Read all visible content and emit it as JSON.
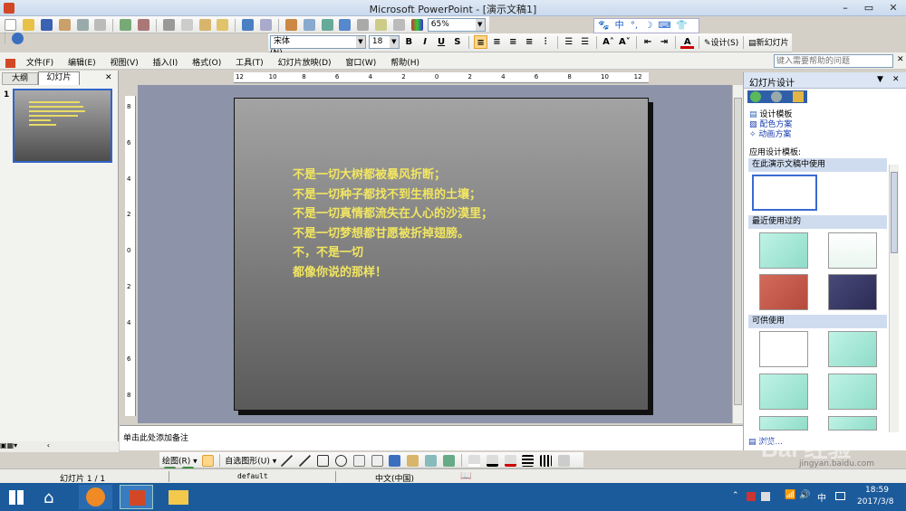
{
  "window": {
    "title": "Microsoft PowerPoint - [演示文稿1]",
    "minimize": "–",
    "restore": "▭",
    "close": "✕"
  },
  "toolbar_std": {
    "zoom": "65%"
  },
  "ime": {
    "lang": "中",
    "punct": "°,",
    "moon": "☽"
  },
  "format": {
    "font": "宋体",
    "size": "18",
    "bold": "B",
    "italic": "I",
    "underline": "U",
    "shadow": "S",
    "design_label": "设计(S)",
    "new_slide_label": "新幻灯片(N)"
  },
  "menubar": {
    "items": [
      "文件(F)",
      "编辑(E)",
      "视图(V)",
      "插入(I)",
      "格式(O)",
      "工具(T)",
      "幻灯片放映(D)",
      "窗口(W)",
      "帮助(H)"
    ],
    "help_search_placeholder": "键入需要帮助的问题"
  },
  "ruler": {
    "labels": [
      "12",
      "10",
      "8",
      "6",
      "4",
      "2",
      "0",
      "2",
      "4",
      "6",
      "8",
      "10",
      "12"
    ],
    "vlabels": [
      "8",
      "6",
      "4",
      "2",
      "0",
      "2",
      "4",
      "6",
      "8"
    ]
  },
  "outline_pane": {
    "tab_outline": "大纲",
    "tab_slides": "幻灯片",
    "slide_number": "1"
  },
  "slide": {
    "lines": [
      "不是一切大树都被暴风折断；",
      "不是一切种子都找不到生根的土壤；",
      "不是一切真情都流失在人心的沙漠里；",
      "不是一切梦想都甘愿被折掉翅膀。",
      "不，不是一切",
      "都像你说的那样！"
    ],
    "text_color": "#f2e661"
  },
  "notes": {
    "placeholder": "单击此处添加备注"
  },
  "task_pane": {
    "title": "幻灯片设计",
    "links": [
      {
        "label": "设计模板",
        "active": true
      },
      {
        "label": "配色方案",
        "active": false
      },
      {
        "label": "动画方案",
        "active": false
      }
    ],
    "apply_label": "应用设计模板:",
    "sections": [
      "在此演示文稿中使用",
      "最近使用过的",
      "可供使用"
    ],
    "browse_label": "浏览..."
  },
  "drawing": {
    "draw_label": "绘图(R)",
    "autoshapes_label": "自选图形(U)"
  },
  "statusbar": {
    "slide": "幻灯片 1 / 1",
    "design": "default",
    "language": "中文(中国)"
  },
  "clock": {
    "time": "18:59",
    "date": "2017/3/8"
  },
  "tray": {
    "ime": "中"
  },
  "watermark": {
    "logo": "Bai 经验",
    "url": "jingyan.baidu.com"
  },
  "colors": {
    "slide_bg_top": "#a3a3a3",
    "slide_bg_bottom": "#5a5a5a",
    "editor_bg": "#8d93a9",
    "taskbar": "#1c5b9b"
  }
}
